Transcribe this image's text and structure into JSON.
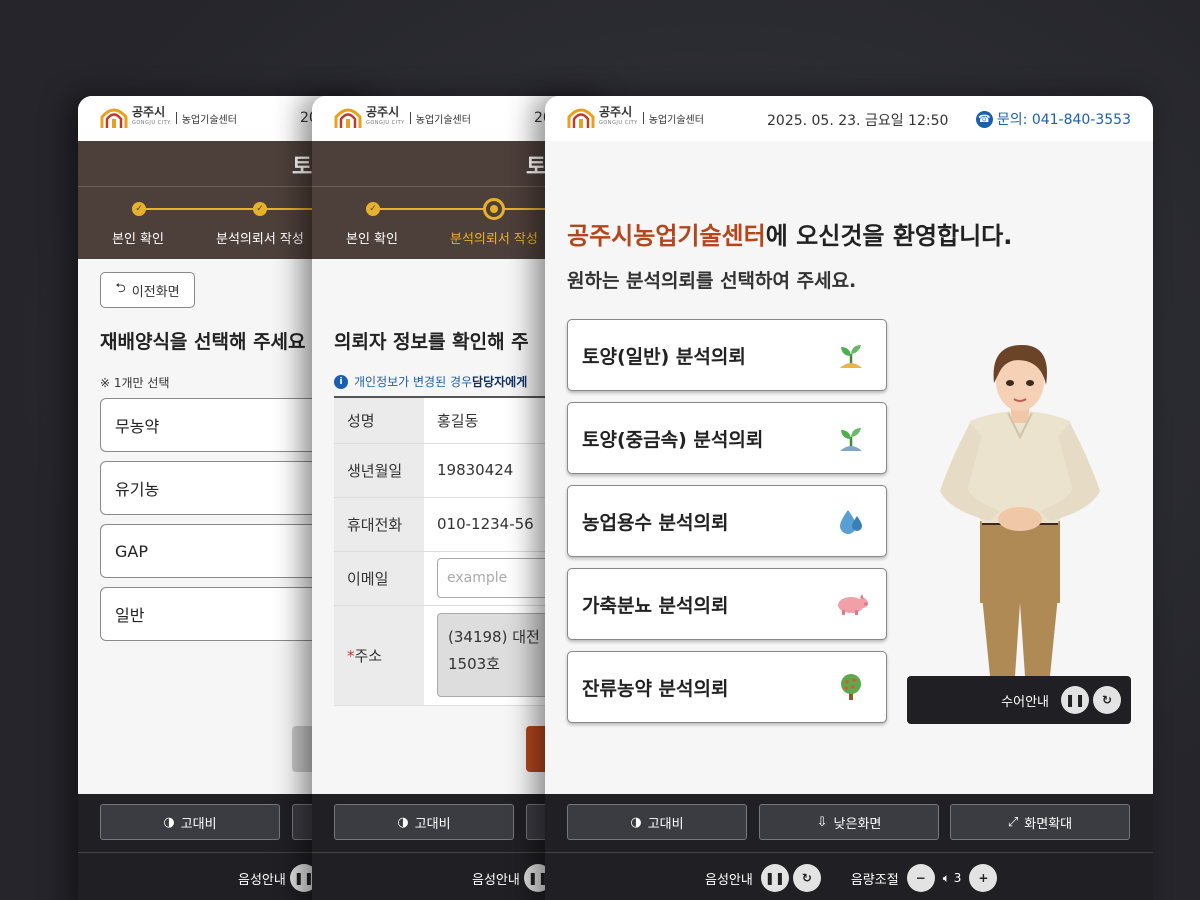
{
  "header": {
    "logo_city": "공주시",
    "logo_city_en": "GONGJU CITY",
    "logo_center": "농업기술센터",
    "datetime": "2025. 05. 23. 금요일 12:50",
    "datetime_partial": "20",
    "contact_label": "문의: 041-840-3553"
  },
  "steps": {
    "header_partial": "토",
    "step1": "본인 확인",
    "step2": "분석의뢰서 작성",
    "step2_partial": "분석의뢰서 작성"
  },
  "screen1": {
    "back_button": "이전화면",
    "heading": "재배양식을 선택해 주세요",
    "note": "※ 1개만 선택",
    "options": [
      "무농약",
      "유기농",
      "GAP",
      "일반"
    ]
  },
  "screen2": {
    "heading": "의뢰자 정보를 확인해 주",
    "info_text": "개인정보가 변경된 경우 ",
    "info_bold": "담당자에게",
    "fields": {
      "name_label": "성명",
      "name_value": "홍길동",
      "birth_label": "생년월일",
      "birth_value": "19830424",
      "phone_label": "휴대전화",
      "phone_value": "010-1234-56",
      "email_label": "이메일",
      "email_placeholder": "example",
      "addr_required": "*",
      "addr_label": "주소",
      "addr_line1": "(34198) 대전",
      "addr_line2": "1503호"
    }
  },
  "screen3": {
    "welcome_highlight": "공주시농업기술센터",
    "welcome_rest": "에 오신것을 환영합니다.",
    "subtitle": "원하는 분석의뢰를 선택하여 주세요.",
    "menu": [
      {
        "label": "토양(일반) 분석의뢰",
        "icon": "sprout-icon"
      },
      {
        "label": "토양(중금속) 분석의뢰",
        "icon": "sprout-icon"
      },
      {
        "label": "농업용수 분석의뢰",
        "icon": "water-drop-icon"
      },
      {
        "label": "가축분뇨 분석의뢰",
        "icon": "pig-icon"
      },
      {
        "label": "잔류농약 분석의뢰",
        "icon": "tree-icon"
      }
    ],
    "sign_language_label": "수어안내"
  },
  "bottom": {
    "contrast": "고대비",
    "low_screen": "낮은화면",
    "zoom": "화면확대",
    "voice_guide": "음성안내",
    "volume_label": "음량조절",
    "volume_value": "3"
  },
  "colors": {
    "brown_header": "#4d3f3a",
    "accent_gold": "#e7b22b",
    "welcome_orange": "#b5461c",
    "contact_blue": "#1b5fb0",
    "bottom_bar": "#1f1f24",
    "page_background": "#25252b"
  }
}
